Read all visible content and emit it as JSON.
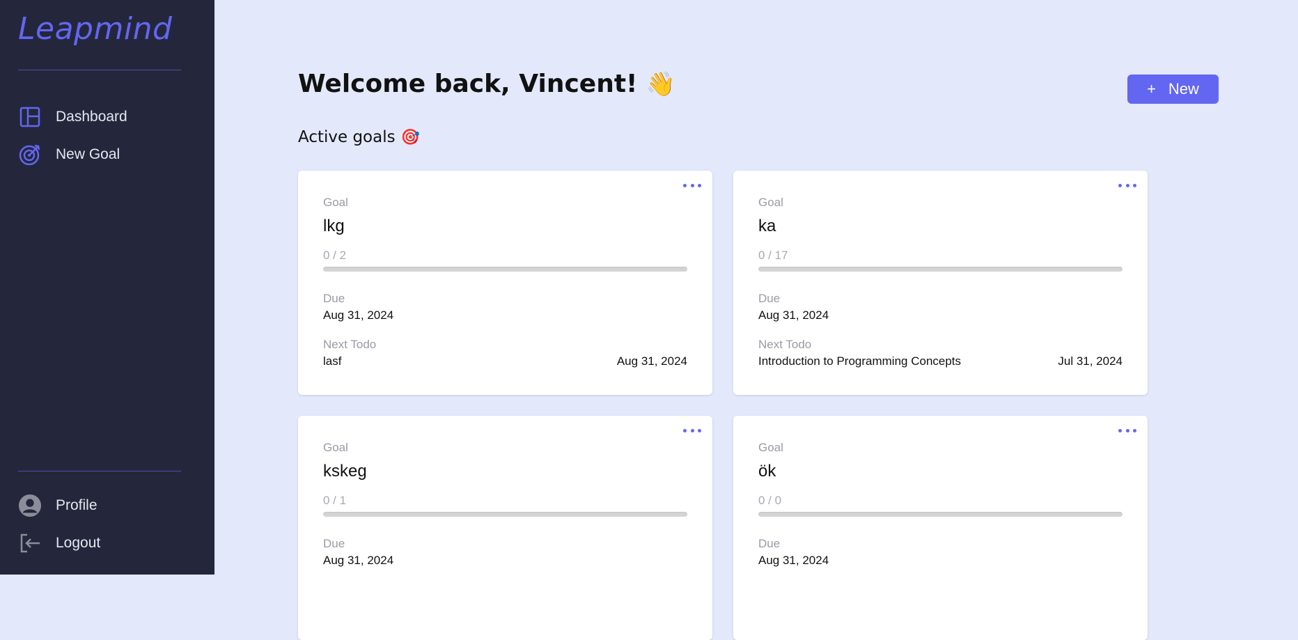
{
  "app": {
    "logo": "Leapmind"
  },
  "sidebar": {
    "items": [
      {
        "label": "Dashboard",
        "icon": "layout-icon"
      },
      {
        "label": "New Goal",
        "icon": "target-icon"
      }
    ],
    "bottom_items": [
      {
        "label": "Profile",
        "icon": "user-circle-icon"
      },
      {
        "label": "Logout",
        "icon": "logout-icon"
      }
    ]
  },
  "header": {
    "welcome": "Welcome back, Vincent!",
    "welcome_emoji": "👋",
    "new_button": {
      "plus": "+",
      "label": "New"
    }
  },
  "section": {
    "title": "Active goals",
    "emoji": "🎯"
  },
  "cards": [
    {
      "goal_label": "Goal",
      "name": "lkg",
      "progress": "0 / 2",
      "progress_fraction": 0,
      "due_label": "Due",
      "due": "Aug 31, 2024",
      "next_label": "Next Todo",
      "next_todo": "lasf",
      "next_date": "Aug 31, 2024"
    },
    {
      "goal_label": "Goal",
      "name": "ka",
      "progress": "0 / 17",
      "progress_fraction": 0,
      "due_label": "Due",
      "due": "Aug 31, 2024",
      "next_label": "Next Todo",
      "next_todo": "Introduction to Programming Concepts",
      "next_date": "Jul 31, 2024"
    },
    {
      "goal_label": "Goal",
      "name": "kskeg",
      "progress": "0 / 1",
      "progress_fraction": 0,
      "due_label": "Due",
      "due": "Aug 31, 2024"
    },
    {
      "goal_label": "Goal",
      "name": "ök",
      "progress": "0 / 0",
      "progress_fraction": 0,
      "due_label": "Due",
      "due": "Aug 31, 2024"
    }
  ],
  "colors": {
    "accent": "#6366f1",
    "sidebar_bg": "#24273b",
    "page_bg": "#e3e8fb"
  }
}
